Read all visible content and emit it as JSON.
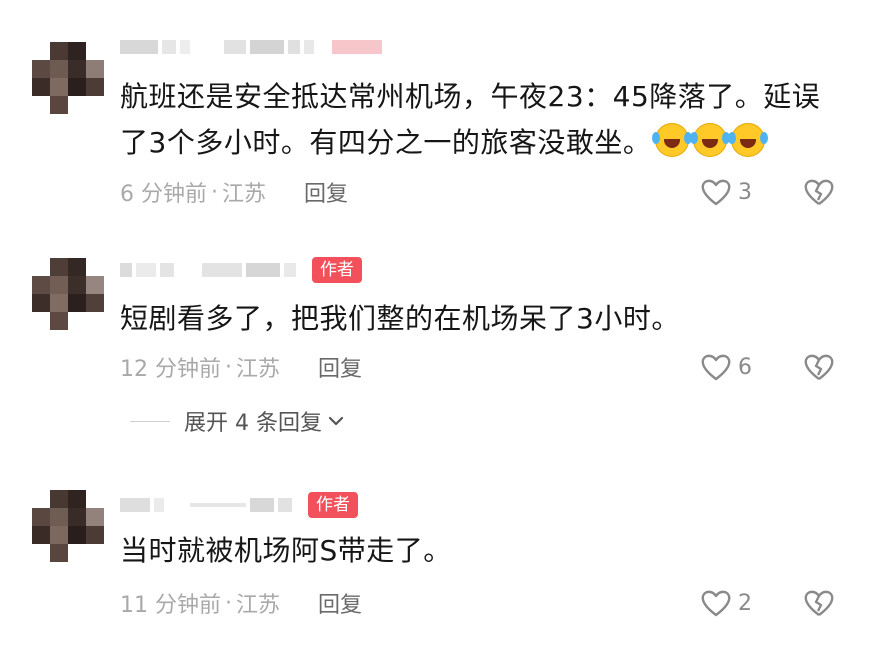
{
  "comments": [
    {
      "text": "航班还是安全抵达常州机场，午夜23：45降落了。延误了3个多小时。有四分之一的旅客没敢坐。",
      "emoji_count": 3,
      "author_badge": "",
      "time": "6 分钟前",
      "location": "江苏",
      "reply_label": "回复",
      "likes": "3"
    },
    {
      "text": "短剧看多了，把我们整的在机场呆了3小时。",
      "author_badge": "作者",
      "time": "12 分钟前",
      "location": "江苏",
      "reply_label": "回复",
      "likes": "6"
    },
    {
      "text": "当时就被机场阿S带走了。",
      "author_badge": "作者",
      "time": "11 分钟前",
      "location": "江苏",
      "reply_label": "回复",
      "likes": "2"
    }
  ],
  "expand_replies": "展开 4 条回复",
  "separator": "·",
  "icons": {
    "like": "heart-outline-icon",
    "dislike": "broken-heart-icon",
    "expand": "chevron-down-icon",
    "emoji": "laughing-crying-emoji-icon"
  },
  "colors": {
    "author_badge": "#f2505a",
    "meta_text": "#a9a9a9"
  }
}
